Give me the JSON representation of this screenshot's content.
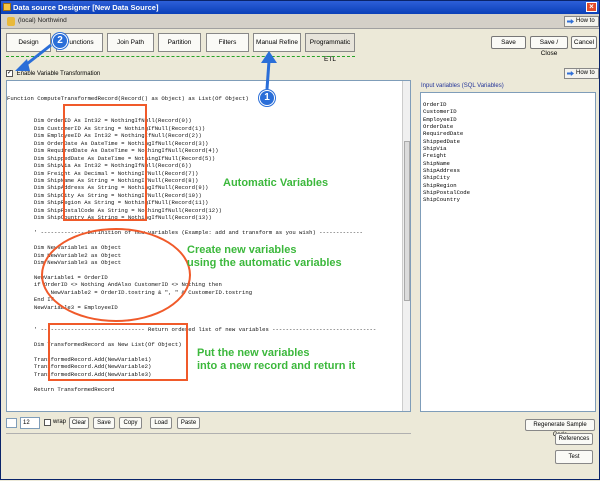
{
  "window": {
    "title": "Data source Designer [New Data Source]",
    "close_glyph": "×",
    "connection": "(local) Northwind"
  },
  "howto": {
    "label": "How to"
  },
  "steps": [
    {
      "label": "Design"
    },
    {
      "label": "Functions"
    },
    {
      "label": "Join Path"
    },
    {
      "label": "Partition"
    },
    {
      "label": "Filters"
    },
    {
      "label": "Manual Refine"
    },
    {
      "label": "Programmatic ETL"
    }
  ],
  "main_buttons": {
    "save": "Save",
    "save_close": "Save / Close",
    "cancel": "Cancel"
  },
  "enable_vt": {
    "label": "Enable Variable Transformation",
    "checked_glyph": "✓"
  },
  "code_lines": [
    "Function ComputeTransformedRecord(Record() as Object) as List(Of Object)",
    "",
    "",
    "        Dim OrderID As Int32 = NothingIfNull(Record(0))",
    "        Dim CustomerID As String = NothingIfNull(Record(1))",
    "        Dim EmployeeID As Int32 = NothingIfNull(Record(2))",
    "        Dim OrderDate As DateTime = NothingIfNull(Record(3))",
    "        Dim RequiredDate As DateTime = NothingIfNull(Record(4))",
    "        Dim ShippedDate As DateTime = NothingIfNull(Record(5))",
    "        Dim ShipVia As Int32 = NothingIfNull(Record(6))",
    "        Dim Freight As Decimal = NothingIfNull(Record(7))",
    "        Dim ShipName As String = NothingIfNull(Record(8))",
    "        Dim ShipAddress As String = NothingIfNull(Record(9))",
    "        Dim ShipCity As String = NothingIfNull(Record(10))",
    "        Dim ShipRegion As String = NothingIfNull(Record(11))",
    "        Dim ShipPostalCode As String = NothingIfNull(Record(12))",
    "        Dim ShipCountry As String = NothingIfNull(Record(13))",
    "",
    "        ' ------------- Definition of new variables (Example: add and transform as you wish) -------------",
    "",
    "        Dim NewVariable1 as Object",
    "        Dim NewVariable2 as Object",
    "        Dim NewVariable3 as Object",
    "",
    "        NewVariable1 = OrderID",
    "        if OrderID <> Nothing AndAlso CustomerID <> Nothing then",
    "             NewVariable2 = OrderID.tostring & \", \" & CustomerID.tostring",
    "        End If",
    "        NewVariable3 = EmployeeID",
    "",
    "",
    "        ' ------------------------------- Return ordered list of new variables -------------------------------",
    "",
    "        Dim TransformedRecord as New List(Of Object)",
    "",
    "        TransformedRecord.Add(NewVariable1)",
    "        TransformedRecord.Add(NewVariable2)",
    "        TransformedRecord.Add(NewVariable3)",
    "",
    "        Return TransformedRecord",
    "",
    "",
    "",
    "",
    "End Function"
  ],
  "input_vars": {
    "title": "Input variables (SQL Variables)",
    "items": [
      "OrderID",
      "CustomerID",
      "EmployeeID",
      "OrderDate",
      "RequiredDate",
      "ShippedDate",
      "ShipVia",
      "Freight",
      "ShipName",
      "ShipAddress",
      "ShipCity",
      "ShipRegion",
      "ShipPostalCode",
      "ShipCountry"
    ]
  },
  "toolbar": {
    "font_size": "12",
    "wrap_label": "wrap",
    "clear": "Clear",
    "save": "Save",
    "copy": "Copy",
    "load": "Load",
    "paste": "Paste"
  },
  "right_buttons": {
    "regenerate": "Regenerate Sample Code",
    "references": "References",
    "test": "Test"
  },
  "annotations": {
    "automatic": "Automatic Variables",
    "create": "Create new variables\nusing the automatic variables",
    "put": "Put the new variables\ninto a new record and return it",
    "badge1": "1",
    "badge2": "2",
    "badge_color": "#2a6ed8",
    "annotation_color": "#f05a2a",
    "text_color": "#3cb83c"
  }
}
